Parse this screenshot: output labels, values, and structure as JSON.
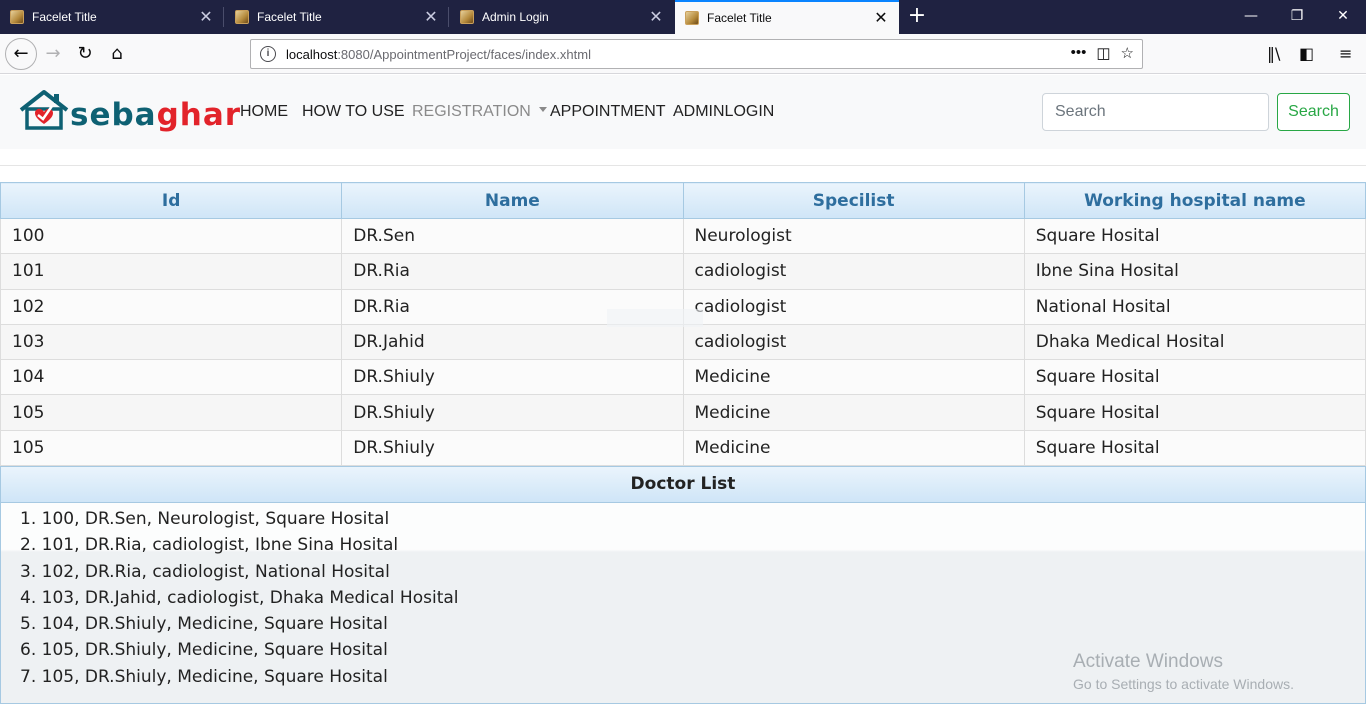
{
  "browser": {
    "tabs": [
      {
        "title": "Facelet Title"
      },
      {
        "title": "Facelet Title"
      },
      {
        "title": "Admin Login"
      },
      {
        "title": "Facelet Title"
      }
    ],
    "url_host": "localhost",
    "url_path": ":8080/AppointmentProject/faces/index.xhtml"
  },
  "site": {
    "logo_part1": "seba",
    "logo_part2": "ghar",
    "nav": [
      "HOME",
      "HOW TO USE",
      "REGISTRATION",
      "APPOINTMENT",
      "ADMINLOGIN"
    ],
    "search_placeholder": "Search",
    "search_button": "Search",
    "colors": {
      "brand_teal": "#0e6173",
      "brand_red": "#e2232a",
      "search_green": "#28a745",
      "header_blue": "#2e6e9e"
    }
  },
  "table": {
    "headers": [
      "Id",
      "Name",
      "Specilist",
      "Working hospital name"
    ],
    "rows": [
      [
        "100",
        "DR.Sen",
        "Neurologist",
        "Square Hosital"
      ],
      [
        "101",
        "DR.Ria",
        "cadiologist",
        "Ibne Sina Hosital"
      ],
      [
        "102",
        "DR.Ria",
        "cadiologist",
        "National Hosital"
      ],
      [
        "103",
        "DR.Jahid",
        "cadiologist",
        "Dhaka Medical Hosital"
      ],
      [
        "104",
        "DR.Shiuly",
        "Medicine",
        "Square Hosital"
      ],
      [
        "105",
        "DR.Shiuly",
        "Medicine",
        "Square Hosital"
      ],
      [
        "105",
        "DR.Shiuly",
        "Medicine",
        "Square Hosital"
      ]
    ]
  },
  "doctor_list": {
    "title": "Doctor List",
    "items": [
      "1. 100, DR.Sen, Neurologist, Square Hosital",
      "2. 101, DR.Ria, cadiologist, Ibne Sina Hosital",
      "3. 102, DR.Ria, cadiologist, National Hosital",
      "4. 103, DR.Jahid, cadiologist, Dhaka Medical Hosital",
      "5. 104, DR.Shiuly, Medicine, Square Hosital",
      "6. 105, DR.Shiuly, Medicine, Square Hosital",
      "7. 105, DR.Shiuly, Medicine, Square Hosital"
    ]
  },
  "watermark": {
    "line1": "Activate Windows",
    "line2": "Go to Settings to activate Windows."
  }
}
